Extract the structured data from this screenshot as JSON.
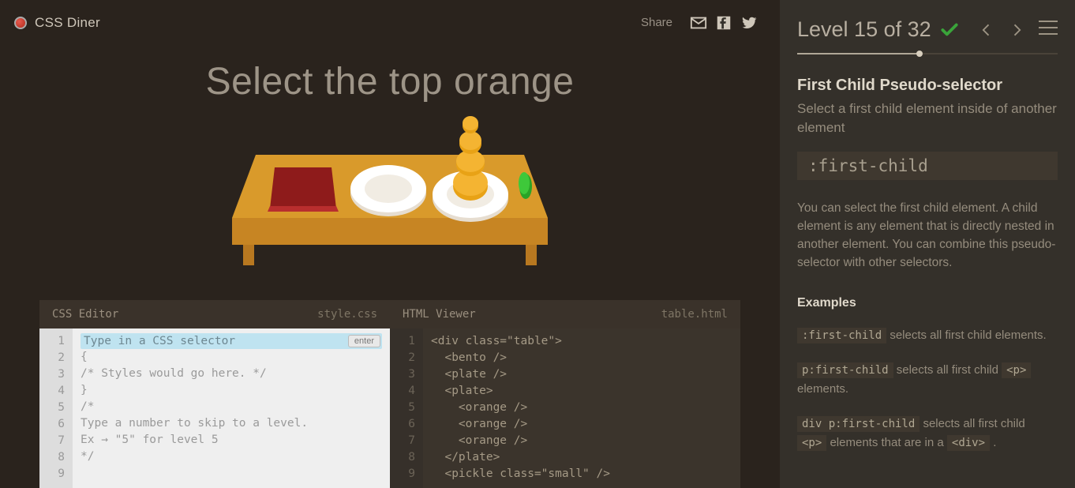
{
  "header": {
    "brand": "CSS Diner",
    "share": "Share"
  },
  "title": "Select the top orange",
  "editor": {
    "css_label": "CSS Editor",
    "css_file": "style.css",
    "html_label": "HTML Viewer",
    "html_file": "table.html",
    "input_placeholder": "Type in a CSS selector",
    "enter": "enter",
    "css_lines": [
      "{",
      "/* Styles would go here. */",
      "}",
      "",
      "/*",
      "Type a number to skip to a level.",
      "Ex → \"5\" for level 5",
      "*/"
    ],
    "html_lines": [
      "<div class=\"table\">",
      "  <bento />",
      "  <plate />",
      "  <plate>",
      "    <orange />",
      "    <orange />",
      "    <orange />",
      "  </plate>",
      "  <pickle class=\"small\" />"
    ]
  },
  "sidebar": {
    "level": "Level 15 of 32",
    "section_title": "First Child Pseudo-selector",
    "subtitle": "Select a first child element inside of another element",
    "selector": ":first-child",
    "hint": "You can select the first child element. A child element is any element that is directly nested in another element. You can combine this pseudo-selector with other selectors.",
    "examples_h": "Examples",
    "ex1_code": ":first-child",
    "ex1_text": " selects all first child elements.",
    "ex2_code": "p:first-child",
    "ex2_mid": " selects all first child ",
    "ex2_tag": "<p>",
    "ex2_end": " elements.",
    "ex3_code": "div p:first-child",
    "ex3_mid": " selects all first child ",
    "ex3_tag1": "<p>",
    "ex3_mid2": " elements that are in a ",
    "ex3_tag2": "<div>",
    "ex3_end": " ."
  }
}
